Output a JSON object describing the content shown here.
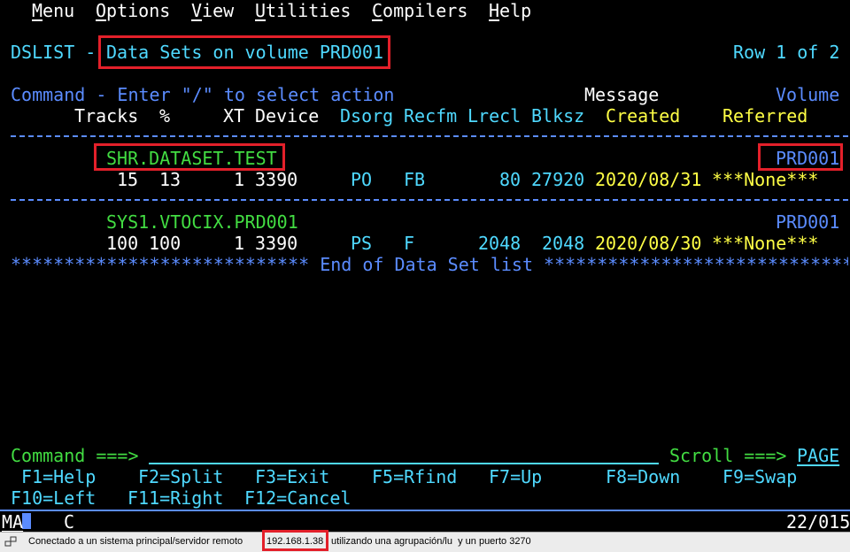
{
  "menu": {
    "items": [
      {
        "label": "Menu",
        "underline": "M"
      },
      {
        "label": "Options",
        "underline": "O"
      },
      {
        "label": "View",
        "underline": "V"
      },
      {
        "label": "Utilities",
        "underline": "U"
      },
      {
        "label": "Compilers",
        "underline": "C"
      },
      {
        "label": "Help",
        "underline": "H"
      }
    ]
  },
  "header": {
    "panel_id": "DSLIST -",
    "title": "Data Sets on volume PRD001",
    "row_info": "Row 1 of 2"
  },
  "columns": {
    "command_hint": "Command - Enter \"/\" to select action",
    "message": "Message",
    "volume": "Volume",
    "tracks": "Tracks",
    "percent": "%",
    "xt": "XT",
    "device": "Device",
    "dsorg": "Dsorg",
    "recfm": "Recfm",
    "lrecl": "Lrecl",
    "blksz": "Blksz",
    "created": "Created",
    "referred": "Referred"
  },
  "datasets": [
    {
      "name": "SHR.DATASET.TEST",
      "volume": "PRD001",
      "tracks": "15",
      "percent": "13",
      "xt": "1",
      "device": "3390",
      "dsorg": "PO",
      "recfm": "FB",
      "lrecl": "80",
      "blksz": "27920",
      "created": "2020/08/31",
      "referred": "***None***"
    },
    {
      "name": "SYS1.VTOCIX.PRD001",
      "volume": "PRD001",
      "tracks": "100",
      "percent": "100",
      "xt": "1",
      "device": "3390",
      "dsorg": "PS",
      "recfm": "F",
      "lrecl": "2048",
      "blksz": "2048",
      "created": "2020/08/30",
      "referred": "***None***"
    }
  ],
  "end_of_list": "**************************** End of Data Set list ******************************",
  "command": {
    "label": "Command ===>",
    "value": "",
    "scroll_label": "Scroll ===>",
    "scroll_value": "PAGE"
  },
  "fkeys": {
    "row1": [
      "F1=Help",
      "F2=Split",
      "F3=Exit",
      "F5=Rfind",
      "F7=Up",
      "F8=Down",
      "F9=Swap"
    ],
    "row2": [
      "F10=Left",
      "F11=Right",
      "F12=Cancel"
    ]
  },
  "oia": {
    "left": "MA",
    "mid": "C",
    "cursor_pos": "22/015"
  },
  "statusbar": {
    "text": "Conectado a un sistema principal/servidor remoto",
    "ip": "192.168.1.38",
    "text2": "utilizando una agrupación/lu  y un puerto 3270"
  },
  "colors": {
    "background": "#000000",
    "white": "#ffffff",
    "blue": "#5b8cff",
    "turquoise": "#4fd9ff",
    "green": "#42dc42",
    "yellow": "#ffff45",
    "highlight_red": "#e3202a"
  }
}
